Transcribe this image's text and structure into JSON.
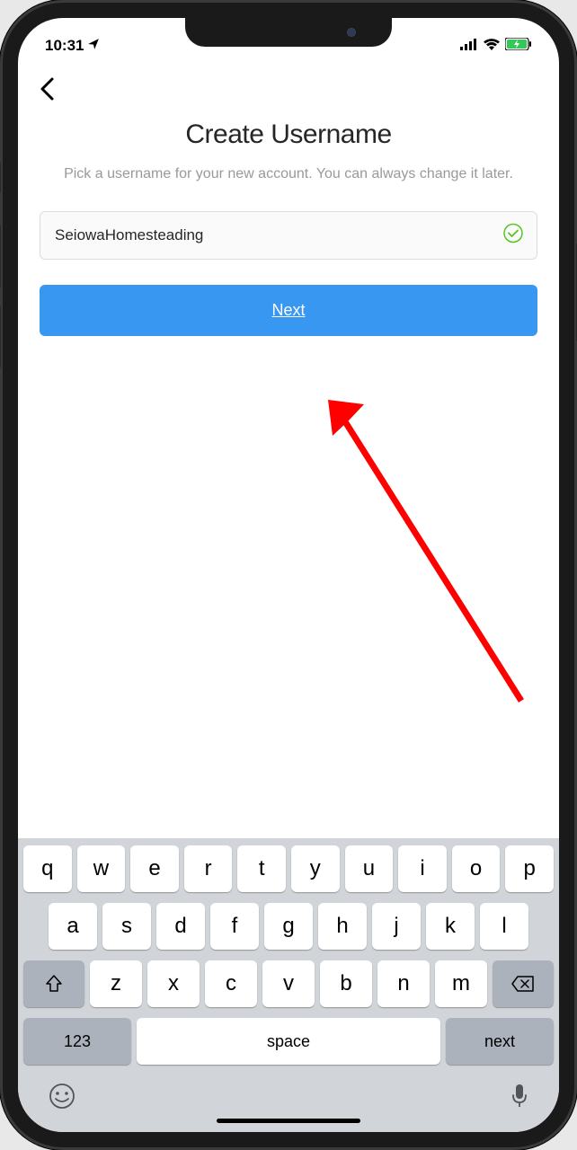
{
  "status": {
    "time": "10:31",
    "location_icon": "location-arrow"
  },
  "nav": {
    "back_icon": "chevron-left"
  },
  "page": {
    "title": "Create Username",
    "subtitle": "Pick a username for your new account. You can always change it later."
  },
  "form": {
    "username_value": "SeiowaHomesteading",
    "validation": "valid",
    "next_label": "Next"
  },
  "keyboard": {
    "row1": [
      "q",
      "w",
      "e",
      "r",
      "t",
      "y",
      "u",
      "i",
      "o",
      "p"
    ],
    "row2": [
      "a",
      "s",
      "d",
      "f",
      "g",
      "h",
      "j",
      "k",
      "l"
    ],
    "row3": [
      "z",
      "x",
      "c",
      "v",
      "b",
      "n",
      "m"
    ],
    "numeric_label": "123",
    "space_label": "space",
    "action_label": "next"
  },
  "colors": {
    "primary_button": "#3897f0",
    "valid_check": "#58c322",
    "annotation_arrow": "#ff0000"
  }
}
